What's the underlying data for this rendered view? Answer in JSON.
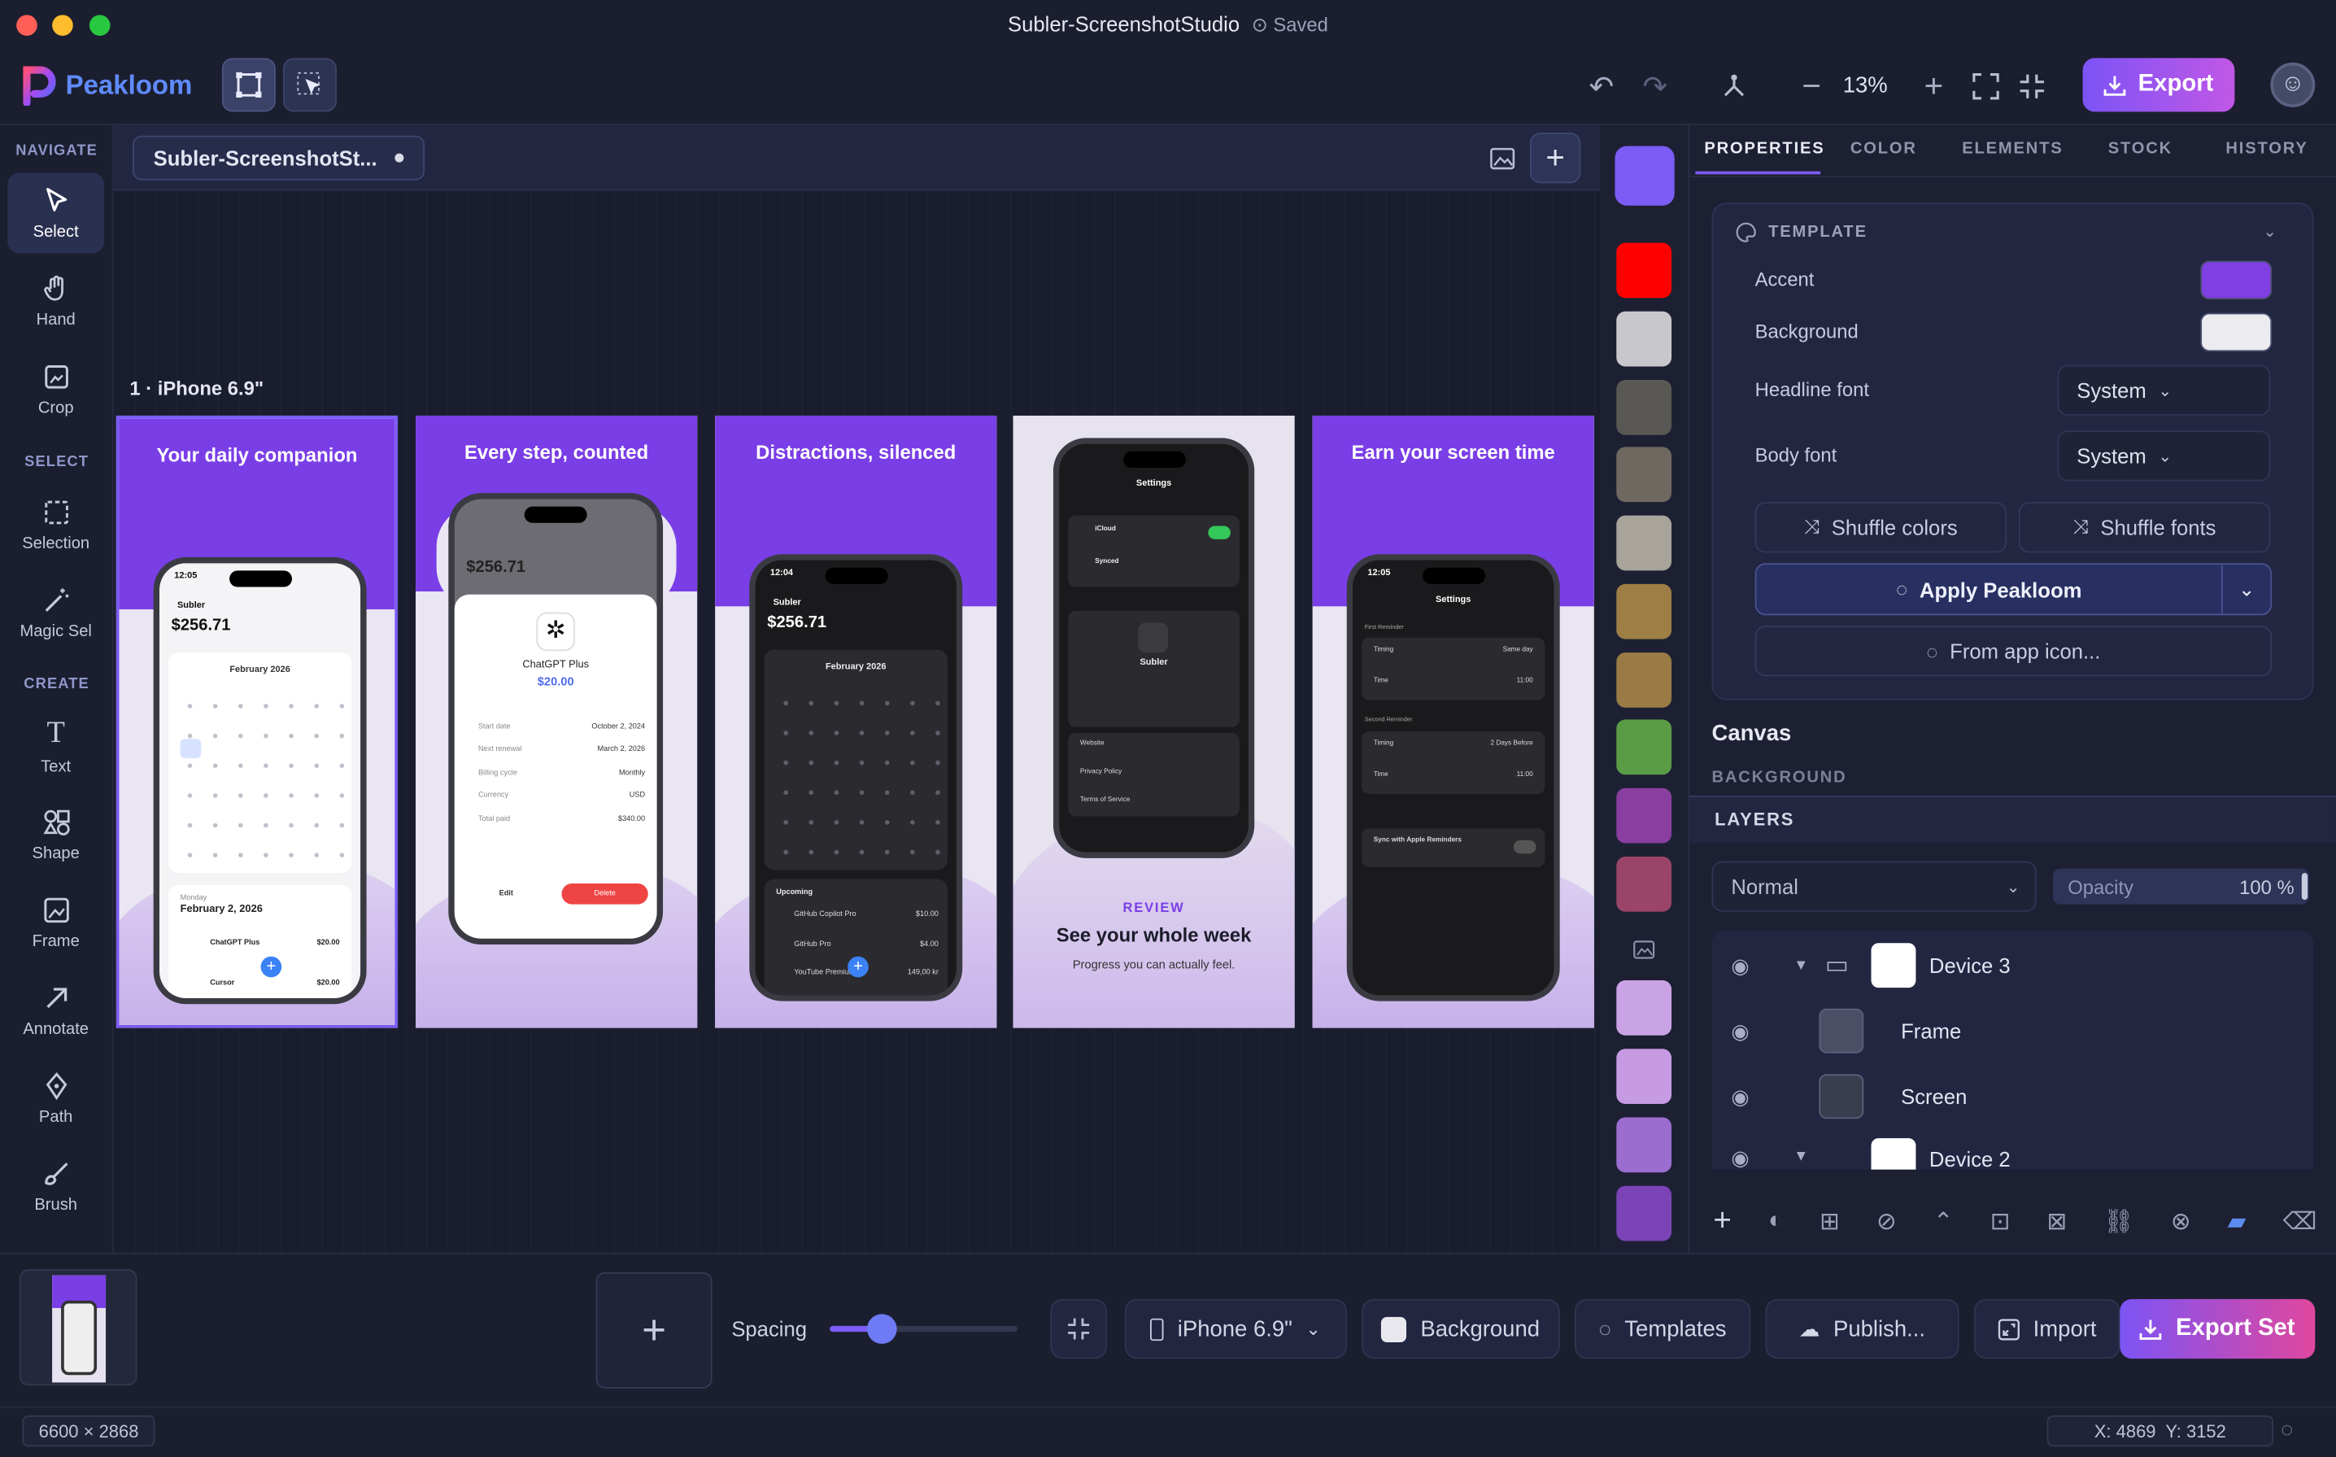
{
  "window": {
    "title": "Subler-ScreenshotStudio",
    "saved_label": "Saved"
  },
  "app": {
    "brand": "Peakloom"
  },
  "toolbar": {
    "zoom": "13%",
    "export_label": "Export"
  },
  "left_rail": {
    "sections": {
      "navigate": "NAVIGATE",
      "select": "SELECT",
      "create": "CREATE"
    },
    "items": [
      {
        "label": "Select",
        "icon": "pointer-icon"
      },
      {
        "label": "Hand",
        "icon": "hand-icon"
      },
      {
        "label": "Crop",
        "icon": "crop-icon"
      },
      {
        "label": "Selection",
        "icon": "selection-icon"
      },
      {
        "label": "Magic Sel",
        "icon": "magic-wand-icon"
      },
      {
        "label": "Text",
        "icon": "text-icon"
      },
      {
        "label": "Shape",
        "icon": "shape-icon"
      },
      {
        "label": "Frame",
        "icon": "frame-icon"
      },
      {
        "label": "Annotate",
        "icon": "arrow-icon"
      },
      {
        "label": "Path",
        "icon": "pen-icon"
      },
      {
        "label": "Brush",
        "icon": "brush-icon"
      }
    ]
  },
  "canvas": {
    "tab_title": "Subler-ScreenshotSt...",
    "set_label": "1 · iPhone 6.9\"",
    "screens": [
      {
        "headline": "Your daily companion"
      },
      {
        "headline": "Every step, counted"
      },
      {
        "headline": "Distractions, silenced"
      },
      {
        "headline": "",
        "tag": "REVIEW",
        "title": "See your whole week",
        "subtitle": "Progress you can actually feel."
      },
      {
        "headline": "Earn your screen time"
      }
    ],
    "phone_text": {
      "time_a": "12:05",
      "time_b": "12:04",
      "app_name": "Subler",
      "balance": "$256.71",
      "month": "February 2026",
      "day_header": "Monday",
      "day_date": "February 2, 2026",
      "item1": "ChatGPT Plus",
      "item1_price": "$20.00",
      "item2": "Cursor",
      "item2_price": "$20.00",
      "detail_name": "ChatGPT Plus",
      "detail_price": "$20.00",
      "start_label": "Start date",
      "start_value": "October 2, 2024",
      "renew_label": "Next renewal",
      "renew_value": "March 2, 2026",
      "billing_label": "Billing cycle",
      "billing_value": "Monthly",
      "currency_label": "Currency",
      "currency_value": "USD",
      "total_label": "Total paid",
      "total_value": "$340.00",
      "edit_label": "Edit",
      "delete_label": "Delete",
      "upcoming": "Upcoming",
      "up1": "GitHub Copilot Pro",
      "up1_price": "$10.00",
      "up2": "GitHub Pro",
      "up2_price": "$4.00",
      "up3": "YouTube Premium",
      "up3_price": "149,00 kr",
      "settings": "Settings",
      "icloud": "iCloud",
      "synced": "Synced",
      "website": "Website",
      "privacy": "Privacy Policy",
      "terms": "Terms of Service",
      "timing": "Timing",
      "time": "Time",
      "same_day": "Same day",
      "two_days": "2 Days Before",
      "t1": "11:00",
      "first_rem": "First Reminder",
      "second_rem": "Second Reminder",
      "apple_rem": "Sync with Apple Reminders"
    }
  },
  "swatches": [
    "#7b5cf5",
    "#ff0000",
    "#c8c8cc",
    "#5a5854",
    "#6f6860",
    "#a8a39b",
    "#9d7e45",
    "#9a7b45",
    "#5a9b45",
    "#8a3ea0",
    "#9a4468",
    "#c9a3e6",
    "#c69be3",
    "#9a6dcf",
    "#7a44b6"
  ],
  "properties": {
    "tabs": [
      "PROPERTIES",
      "COLOR",
      "ELEMENTS",
      "STOCK",
      "HISTORY"
    ],
    "template_title": "TEMPLATE",
    "accent_label": "Accent",
    "accent_color": "#7f3fe3",
    "background_label": "Background",
    "background_color": "#ececf0",
    "headline_font_label": "Headline font",
    "headline_font_value": "System",
    "body_font_label": "Body font",
    "body_font_value": "System",
    "shuffle_colors": "Shuffle colors",
    "shuffle_fonts": "Shuffle fonts",
    "apply_label": "Apply Peakloom",
    "from_icon_label": "From app icon...",
    "canvas_title": "Canvas",
    "background_section": "BACKGROUND"
  },
  "layers": {
    "title": "LAYERS",
    "blend_mode": "Normal",
    "opacity_label": "Opacity",
    "opacity_value": "100 %",
    "items": [
      {
        "name": "Device 3"
      },
      {
        "name": "Frame"
      },
      {
        "name": "Screen"
      },
      {
        "name": "Device 2"
      }
    ]
  },
  "bottom": {
    "spacing_label": "Spacing",
    "spacing_value": 0.28,
    "device_label": "iPhone 6.9\"",
    "background_label": "Background",
    "templates_label": "Templates",
    "publish_label": "Publish...",
    "import_label": "Import",
    "export_set_label": "Export Set"
  },
  "status": {
    "canvas_size": "6600 × 2868",
    "coords": "X: 4869  Y: 3152"
  }
}
